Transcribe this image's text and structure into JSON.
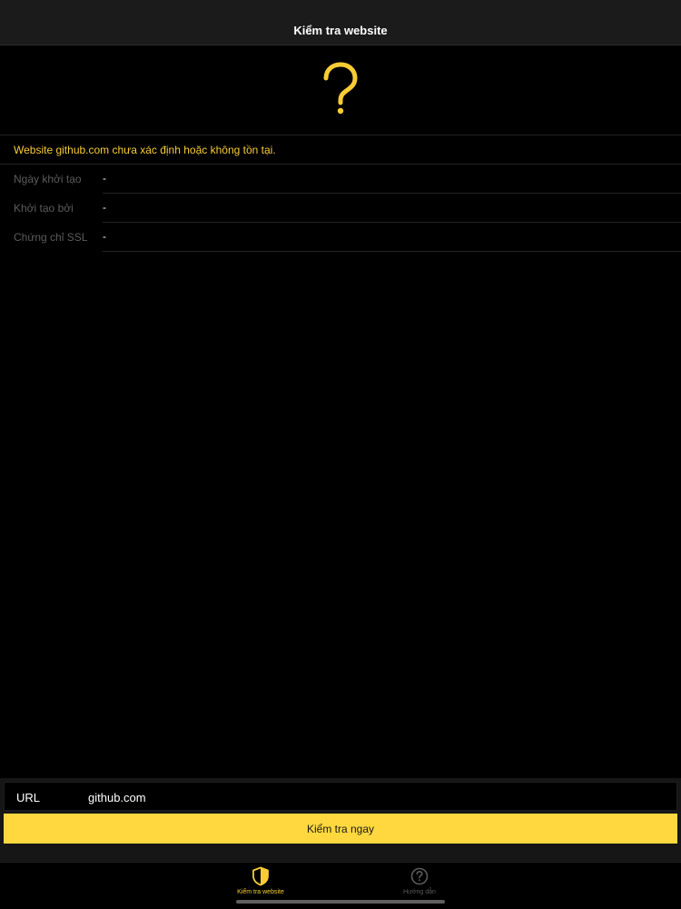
{
  "status_bar": {
    "left_text": "",
    "right_text": ""
  },
  "nav": {
    "title": "Kiểm tra website"
  },
  "result": {
    "icon": "question-mark-icon",
    "message": "Website github.com chưa xác định hoặc không tồn tại.",
    "rows": [
      {
        "label": "Ngày khởi tạo",
        "value": "-"
      },
      {
        "label": "Khởi tạo bởi",
        "value": "-"
      },
      {
        "label": "Chứng chỉ SSL",
        "value": "-"
      }
    ]
  },
  "form": {
    "url_label": "URL",
    "url_value": "github.com",
    "button_label": "Kiểm tra ngay"
  },
  "tabs": [
    {
      "label": "Kiểm tra website",
      "icon": "shield-icon",
      "active": true
    },
    {
      "label": "Hướng dẫn",
      "icon": "help-circle-icon",
      "active": false
    }
  ],
  "colors": {
    "accent": "#f7cc35",
    "button": "#fed83e",
    "background": "#000000"
  }
}
